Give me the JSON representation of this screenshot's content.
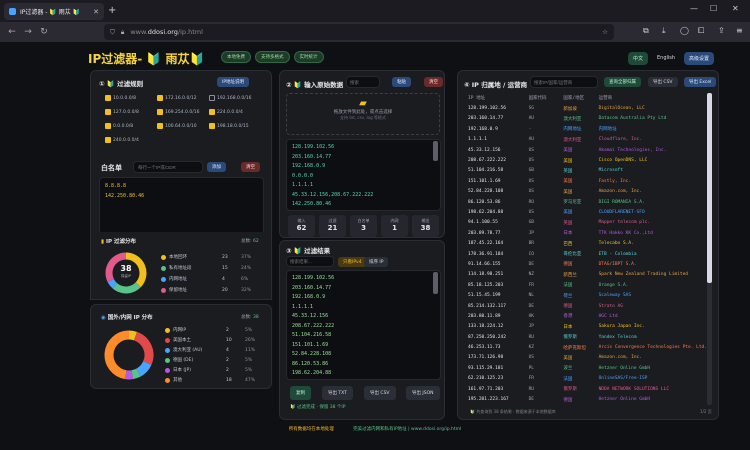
{
  "browser": {
    "tab_title": "IP过滤器 - 🔰 雨苁 🔰",
    "url_prefix": "www.",
    "url_domain": "ddosi.org",
    "url_path": "/ip.html"
  },
  "header": {
    "title": "IP过滤器- 🔰 雨苁🔰",
    "buttons": [
      "本地免费",
      "支持多格式",
      "实时统计"
    ],
    "lang_zh": "中文",
    "lang_en": "English",
    "settings": "高级设置"
  },
  "filter_rules": {
    "title": "① 🔰 过滤规则",
    "button": "IP地址说明",
    "options": [
      {
        "label": "10.0.0.0/8",
        "checked": true
      },
      {
        "label": "172.16.0.0/12",
        "checked": true
      },
      {
        "label": "192.168.0.0/16",
        "checked": false
      },
      {
        "label": "127.0.0.0/8",
        "checked": true
      },
      {
        "label": "169.254.0.0/16",
        "checked": true
      },
      {
        "label": "224.0.0.0/4",
        "checked": true
      },
      {
        "label": "0.0.0.0/8",
        "checked": true
      },
      {
        "label": "100.64.0.0/10",
        "checked": true
      },
      {
        "label": "198.18.0.0/15",
        "checked": true
      },
      {
        "label": "240.0.0.0/4",
        "checked": true
      }
    ],
    "whitelist_label": "白名单",
    "whitelist_placeholder": "每行一个IP或CIDR",
    "whitelist_add": "添加",
    "whitelist_clear": "清空",
    "whitelist_items": [
      "8.8.8.8",
      "142.250.80.46"
    ]
  },
  "dist": {
    "title": "IP 过滤分布",
    "total_label": "总数",
    "total_value": "62",
    "center": "38",
    "center_sub": "保留IP",
    "rows": [
      {
        "label": "本地回环",
        "n": "23",
        "pct": "37%",
        "color": "#f2c01d"
      },
      {
        "label": "私有地址段",
        "n": "15",
        "pct": "24%",
        "color": "#58c38a"
      },
      {
        "label": "内网地址",
        "n": "4",
        "pct": "6%",
        "color": "#4aa3ff"
      },
      {
        "label": "保留地址",
        "n": "20",
        "pct": "32%",
        "color": "#e05a8a"
      }
    ],
    "ring_values": [
      23,
      15,
      4,
      20
    ]
  },
  "geo": {
    "title": "国外/内网 IP 分布",
    "total_label": "总数",
    "total_value": "38",
    "center": "",
    "rows": [
      {
        "label": "内网IP",
        "a": "2",
        "b": "5%",
        "color": "#f2c01d"
      },
      {
        "label": "美国本土",
        "a": "10",
        "b": "26%",
        "color": "#e04a4a"
      },
      {
        "label": "澳大利亚 (AU)",
        "a": "4",
        "b": "11%",
        "color": "#4aa3ff"
      },
      {
        "label": "德国 (DE)",
        "a": "2",
        "b": "5%",
        "color": "#58c38a"
      },
      {
        "label": "日本 (JP)",
        "a": "2",
        "b": "5%",
        "color": "#b35adf"
      },
      {
        "label": "其他",
        "a": "18",
        "b": "47%",
        "color": "#ff8c2a"
      }
    ],
    "ring_values": [
      2,
      10,
      4,
      2,
      2,
      18
    ]
  },
  "input": {
    "title": "② 🔰 输入原始数据",
    "search_placeholder": "搜索",
    "paste": "粘贴",
    "clear": "清空",
    "drop_text": "拖放文件到此处，或点击选择",
    "drop_sub": "支持 txt, csv, log 等格式",
    "lines": [
      "128.199.102.56",
      "203.160.14.77",
      "192.168.0.9",
      "0.0.0.0",
      "1.1.1.1",
      "45.33.12.156,208.67.222.222",
      "142.250.80.46",
      "52.108.216.58"
    ],
    "stats": [
      {
        "label": "输入",
        "value": "62"
      },
      {
        "label": "过滤",
        "value": "21"
      },
      {
        "label": "白名单",
        "value": "3"
      },
      {
        "label": "内网",
        "value": "1"
      },
      {
        "label": "输出",
        "value": "38"
      }
    ]
  },
  "result": {
    "title": "③ 🔰 过滤结果",
    "search_placeholder": "搜索结果...",
    "tag1": "只看IPv4",
    "tag2": "排序 IP",
    "lines": [
      "128.199.102.56",
      "203.160.14.77",
      "192.168.0.9",
      "1.1.1.1",
      "45.33.12.156",
      "208.67.222.222",
      "51.104.216.58",
      "151.101.1.69",
      "52.84.228.108",
      "86.120.53.86",
      "198.62.204.88"
    ],
    "buttons": [
      "复制",
      "导出 TXT",
      "导出 CSV",
      "导出 JSON"
    ],
    "status": "🔰 过滤完成 · 保留 38 个IP"
  },
  "geo_table": {
    "title": "④ IP 归属地 / 运营商",
    "search_placeholder": "搜索IP/国家/运营商",
    "btn_query": "查询全部归属",
    "btn_csv": "导出 CSV",
    "btn_excel": "导出 Excel",
    "columns": [
      "IP 地址",
      "国家代码",
      "国家/地区",
      "运营商"
    ],
    "rows": [
      [
        "128.199.102.56",
        "SG",
        "新加坡",
        "DigitalOcean, LLC"
      ],
      [
        "203.160.14.77",
        "AU",
        "澳大利亚",
        "Datacom Australia Pty Ltd"
      ],
      [
        "192.168.0.9",
        "-",
        "内网地址",
        "内网地址"
      ],
      [
        "1.1.1.1",
        "AU",
        "澳大利亚",
        "Cloudflare, Inc."
      ],
      [
        "45.33.12.156",
        "US",
        "美国",
        "Akamai Technologies, Inc."
      ],
      [
        "208.67.222.222",
        "US",
        "美国",
        "Cisco OpenDNS, LLC"
      ],
      [
        "51.104.216.58",
        "GB",
        "英国",
        "Microsoft"
      ],
      [
        "151.101.1.69",
        "US",
        "美国",
        "Fastly, Inc."
      ],
      [
        "52.84.228.108",
        "US",
        "美国",
        "Amazon.com, Inc."
      ],
      [
        "86.120.53.86",
        "RO",
        "罗马尼亚",
        "DIGI ROMANIA S.A."
      ],
      [
        "198.62.204.88",
        "US",
        "美国",
        "CLOUDFLARENET-SFO"
      ],
      [
        "94.1.100.55",
        "GB",
        "英国",
        "Mapper telecom plc."
      ],
      [
        "203.89.78.77",
        "JP",
        "日本",
        "TTK Hakko KK Co.,Ltd"
      ],
      [
        "187.45.22.164",
        "BR",
        "巴西",
        "Telecabo S.A."
      ],
      [
        "178.36.91.184",
        "CO",
        "哥伦比亚",
        "ETB - Colombia"
      ],
      [
        "91.14.66.155",
        "DE",
        "德国",
        "DTAG/IBPT S.A."
      ],
      [
        "114.18.98.251",
        "NZ",
        "新西兰",
        "Spark New Zealand Trading Limited"
      ],
      [
        "85.18.125.203",
        "FR",
        "法国",
        "Orange S.A."
      ],
      [
        "51.15.45.199",
        "NL",
        "荷兰",
        "Scaleway SAS"
      ],
      [
        "85.214.132.117",
        "DE",
        "德国",
        "Strato AG"
      ],
      [
        "203.80.11.89",
        "HK",
        "香港",
        "HGC Ltd"
      ],
      [
        "133.18.224.12",
        "JP",
        "日本",
        "Sakura Japan Inc."
      ],
      [
        "87.250.250.242",
        "RU",
        "俄罗斯",
        "Yandex Telecom"
      ],
      [
        "46.253.11.73",
        "KZ",
        "哈萨克斯坦",
        "Arcis Convergence Technologies Pte. Ltd."
      ],
      [
        "173.71.126.98",
        "US",
        "美国",
        "Amazon.com, Inc."
      ],
      [
        "93.115.29.181",
        "PL",
        "波兰",
        "Hetzner Online GmbH"
      ],
      [
        "62.210.125.23",
        "FR",
        "法国",
        "OnlineSAS/Free-ISP"
      ],
      [
        "161.97.71.203",
        "RU",
        "俄罗斯",
        "NDDA NETWORK SOLUTIONS LLC"
      ],
      [
        "195.201.223.167",
        "DE",
        "德国",
        "Hetzner Online GmbH"
      ]
    ],
    "footer": "🔰 共查询到 38 条结果 · 数据来源于本地数据库",
    "page": "1/2 页"
  },
  "footer": {
    "left": "所有数据均在本地处理",
    "right": "完美过滤内网和私有IP地址 | www.ddosi.org/ip.html"
  }
}
